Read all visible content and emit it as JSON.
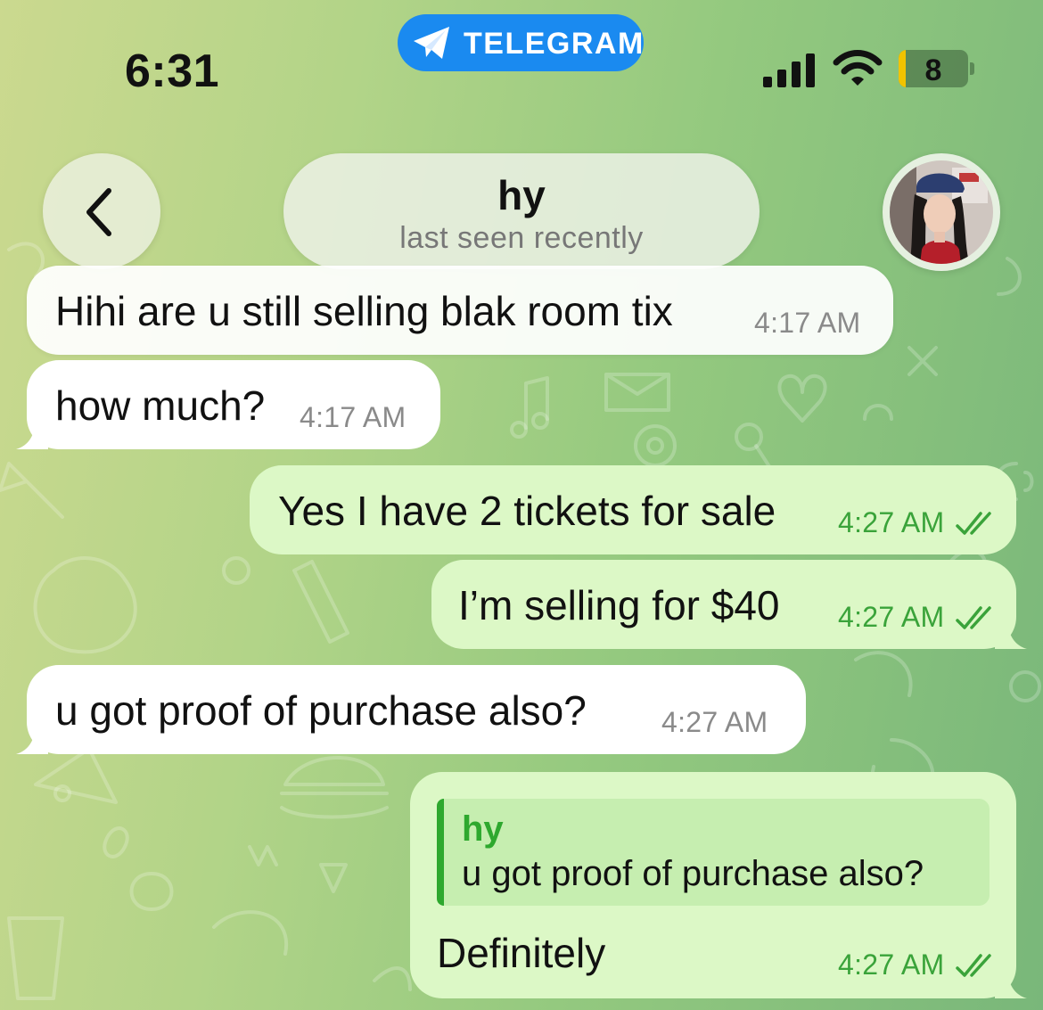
{
  "status_bar": {
    "time": "6:31",
    "app_name": "TELEGRAM",
    "battery_level": "8",
    "battery_fraction": 0.1
  },
  "header": {
    "back_icon": "chevron-left-icon",
    "chat_name": "hy",
    "chat_status": "last seen recently"
  },
  "messages": [
    {
      "direction": "incoming",
      "text": "Hihi are u still selling blak room tix",
      "time": "4:17 AM"
    },
    {
      "direction": "incoming",
      "text": "how much?",
      "time": "4:17 AM"
    },
    {
      "direction": "outgoing",
      "text": "Yes I have 2 tickets for sale",
      "time": "4:27 AM",
      "status": "read"
    },
    {
      "direction": "outgoing",
      "text": "I’m selling for $40",
      "time": "4:27 AM",
      "status": "read"
    },
    {
      "direction": "incoming",
      "text": "u got proof of purchase also?",
      "time": "4:27 AM"
    },
    {
      "direction": "outgoing",
      "reply_to": {
        "name": "hy",
        "text": "u got proof of purchase also?"
      },
      "text": "Definitely",
      "time": "4:27 AM",
      "status": "read"
    }
  ],
  "colors": {
    "incoming_bubble": "#ffffff",
    "outgoing_bubble": "#dcf8c6",
    "outgoing_time": "#3aa33a",
    "telegram_blue": "#1a8af0",
    "reply_accent": "#2ea82e"
  }
}
